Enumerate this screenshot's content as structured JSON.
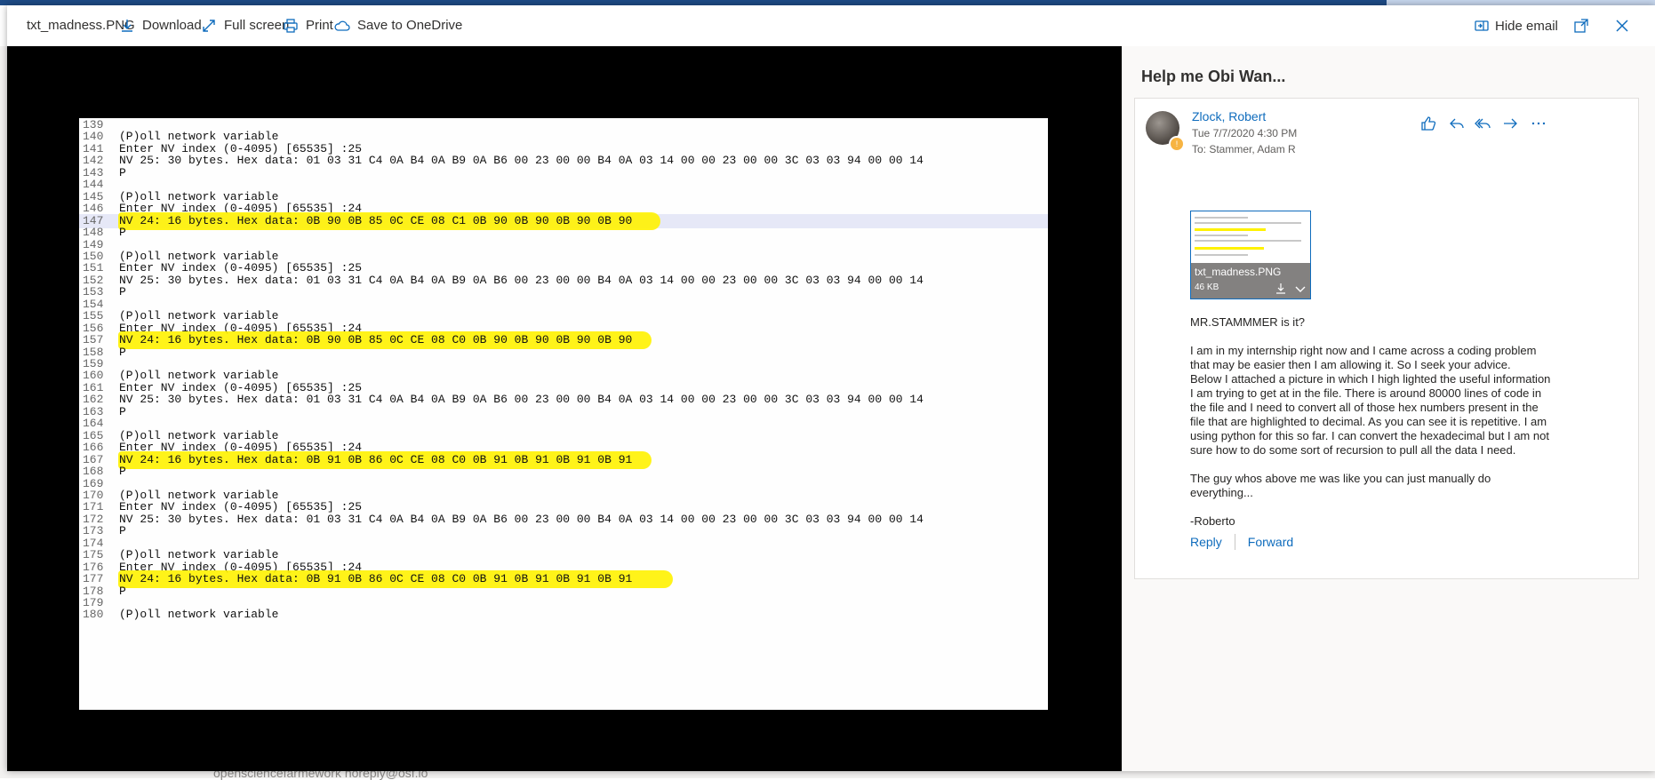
{
  "background": {
    "bottom_text": "opensciencefarmework noreply@osf.io"
  },
  "toolbar": {
    "filename": "txt_madness.PNG",
    "download": "Download",
    "fullscreen": "Full screen",
    "print": "Print",
    "save_onedrive": "Save to OneDrive",
    "hide_email": "Hide email"
  },
  "preview": {
    "lines": [
      {
        "n": "139",
        "t": ""
      },
      {
        "n": "140",
        "t": "(P)oll network variable"
      },
      {
        "n": "141",
        "t": "Enter NV index (0-4095) [65535] :25"
      },
      {
        "n": "142",
        "t": "NV 25: 30 bytes. Hex data: 01 03 31 C4 0A B4 0A B9 0A B6 00 23 00 00 B4 0A 03 14 00 00 23 00 00 3C 03 03 94 00 00 14"
      },
      {
        "n": "143",
        "t": "P"
      },
      {
        "n": "144",
        "t": ""
      },
      {
        "n": "145",
        "t": "(P)oll network variable"
      },
      {
        "n": "146",
        "t": "Enter NV index (0-4095) [65535] :24"
      },
      {
        "n": "147",
        "t": "NV 24: 16 bytes. Hex data: 0B 90 0B 85 0C CE 08 C1 0B 90 0B 90 0B 90 0B 90"
      },
      {
        "n": "148",
        "t": "P"
      },
      {
        "n": "149",
        "t": ""
      },
      {
        "n": "150",
        "t": "(P)oll network variable"
      },
      {
        "n": "151",
        "t": "Enter NV index (0-4095) [65535] :25"
      },
      {
        "n": "152",
        "t": "NV 25: 30 bytes. Hex data: 01 03 31 C4 0A B4 0A B9 0A B6 00 23 00 00 B4 0A 03 14 00 00 23 00 00 3C 03 03 94 00 00 14"
      },
      {
        "n": "153",
        "t": "P"
      },
      {
        "n": "154",
        "t": ""
      },
      {
        "n": "155",
        "t": "(P)oll network variable"
      },
      {
        "n": "156",
        "t": "Enter NV index (0-4095) [65535] :24"
      },
      {
        "n": "157",
        "t": "NV 24: 16 bytes. Hex data: 0B 90 0B 85 0C CE 08 C0 0B 90 0B 90 0B 90 0B 90"
      },
      {
        "n": "158",
        "t": "P"
      },
      {
        "n": "159",
        "t": ""
      },
      {
        "n": "160",
        "t": "(P)oll network variable"
      },
      {
        "n": "161",
        "t": "Enter NV index (0-4095) [65535] :25"
      },
      {
        "n": "162",
        "t": "NV 25: 30 bytes. Hex data: 01 03 31 C4 0A B4 0A B9 0A B6 00 23 00 00 B4 0A 03 14 00 00 23 00 00 3C 03 03 94 00 00 14"
      },
      {
        "n": "163",
        "t": "P"
      },
      {
        "n": "164",
        "t": ""
      },
      {
        "n": "165",
        "t": "(P)oll network variable"
      },
      {
        "n": "166",
        "t": "Enter NV index (0-4095) [65535] :24"
      },
      {
        "n": "167",
        "t": "NV 24: 16 bytes. Hex data: 0B 91 0B 86 0C CE 08 C0 0B 91 0B 91 0B 91 0B 91"
      },
      {
        "n": "168",
        "t": "P"
      },
      {
        "n": "169",
        "t": ""
      },
      {
        "n": "170",
        "t": "(P)oll network variable"
      },
      {
        "n": "171",
        "t": "Enter NV index (0-4095) [65535] :25"
      },
      {
        "n": "172",
        "t": "NV 25: 30 bytes. Hex data: 01 03 31 C4 0A B4 0A B9 0A B6 00 23 00 00 B4 0A 03 14 00 00 23 00 00 3C 03 03 94 00 00 14"
      },
      {
        "n": "173",
        "t": "P"
      },
      {
        "n": "174",
        "t": ""
      },
      {
        "n": "175",
        "t": "(P)oll network variable"
      },
      {
        "n": "176",
        "t": "Enter NV index (0-4095) [65535] :24"
      },
      {
        "n": "177",
        "t": "NV 24: 16 bytes. Hex data: 0B 91 0B 86 0C CE 08 C0 0B 91 0B 91 0B 91 0B 91"
      },
      {
        "n": "178",
        "t": "P"
      },
      {
        "n": "179",
        "t": ""
      },
      {
        "n": "180",
        "t": "(P)oll network variable"
      }
    ],
    "highlight_color": "#fff200"
  },
  "email": {
    "subject": "Help me Obi Wan...",
    "sender": "Zlock, Robert",
    "date": "Tue 7/7/2020 4:30 PM",
    "to": "To:  Stammer, Adam R",
    "attachment": {
      "name": "txt_madness.PNG",
      "size": "46 KB"
    },
    "body": [
      "MR.STAMMMER is it?",
      "I am in my internship right now and I came across a coding problem that may be easier then I am allowing it.  So I seek your advice.\nBelow I attached a picture in which I high lighted the useful information I am trying to get at in the file.  There is around 80000 lines of code in the file and I need to convert all of those hex numbers present in the file that are highlighted to decimal.  As you can see it is repetitive.  I am using python for this so far.  I can convert the hexadecimal but I am not sure how to do some sort of recursion to pull all the data I need.",
      "The guy whos above me was like you can just manually do everything...",
      "-Roberto"
    ],
    "reply": "Reply",
    "forward": "Forward"
  },
  "colors": {
    "accent": "#0f6cbd",
    "viewer_bg": "#000000"
  }
}
